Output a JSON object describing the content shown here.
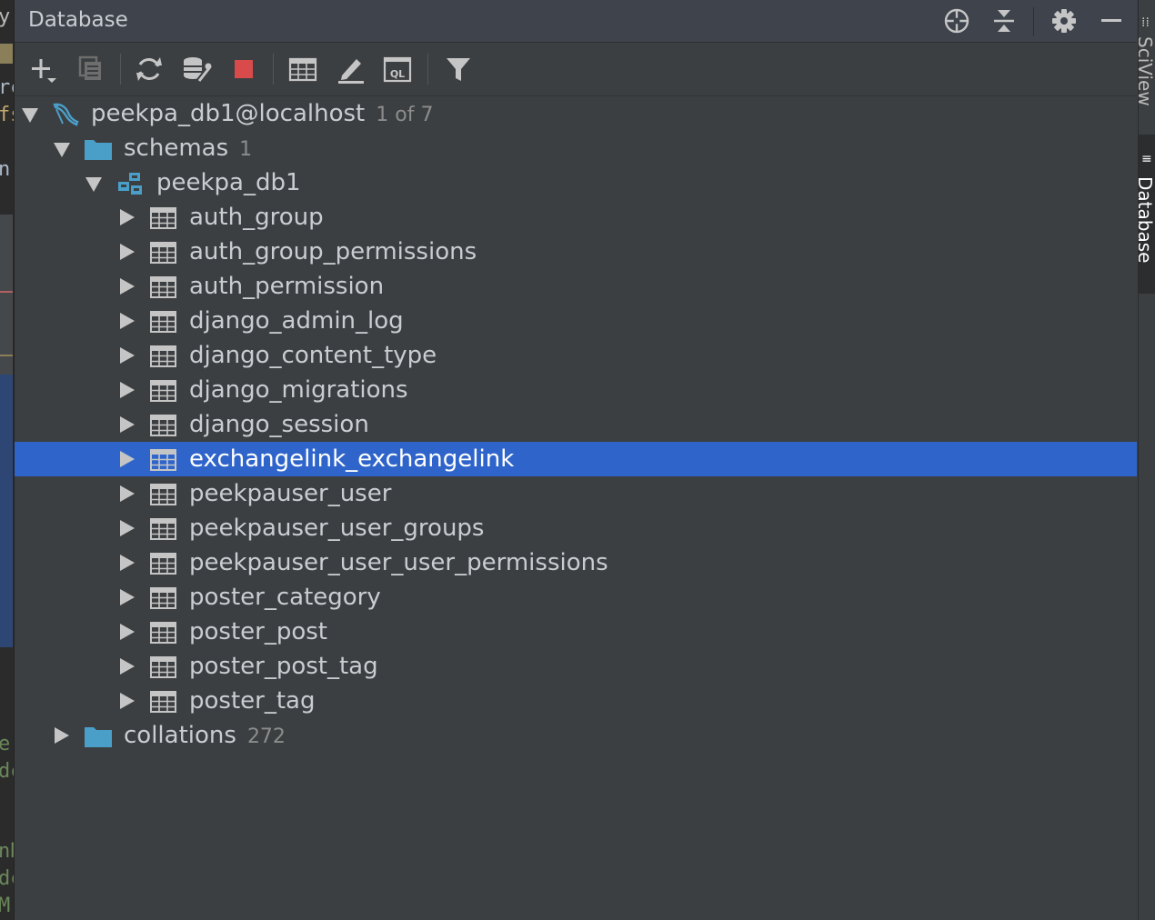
{
  "panel": {
    "title": "Database"
  },
  "header_icons": [
    "crosshair-icon",
    "collapse-all-icon",
    "gear-icon",
    "minimize-icon"
  ],
  "toolbar_icons": [
    "add-icon",
    "duplicate-icon",
    "refresh-icon",
    "db-properties-icon",
    "stop-icon",
    "table-view-icon",
    "edit-icon",
    "sql-console-icon",
    "filter-icon"
  ],
  "toolbar": {
    "sql_glyph": "QL"
  },
  "tree": {
    "connection": {
      "label": "peekpa_db1@localhost",
      "count": "1 of 7"
    },
    "schemas": {
      "label": "schemas",
      "count": "1"
    },
    "schema": {
      "label": "peekpa_db1"
    },
    "tables": [
      "auth_group",
      "auth_group_permissions",
      "auth_permission",
      "django_admin_log",
      "django_content_type",
      "django_migrations",
      "django_session",
      "exchangelink_exchangelink",
      "peekpauser_user",
      "peekpauser_user_groups",
      "peekpauser_user_user_permissions",
      "poster_category",
      "poster_post",
      "poster_post_tag",
      "poster_tag"
    ],
    "selected_table": "exchangelink_exchangelink",
    "collations": {
      "label": "collations",
      "count": "272"
    }
  },
  "right_bar": {
    "tab_top": "SciView",
    "tab_database": "Database"
  },
  "editor_fragments": [
    "y",
    "rc",
    "fs",
    "n",
    "e",
    "dc",
    "nN",
    "dc",
    "M:"
  ],
  "colors": {
    "background": "#3c3f41",
    "selection": "#2f65ca",
    "folder": "#4a9fc9",
    "stop": "#d94b4b"
  }
}
